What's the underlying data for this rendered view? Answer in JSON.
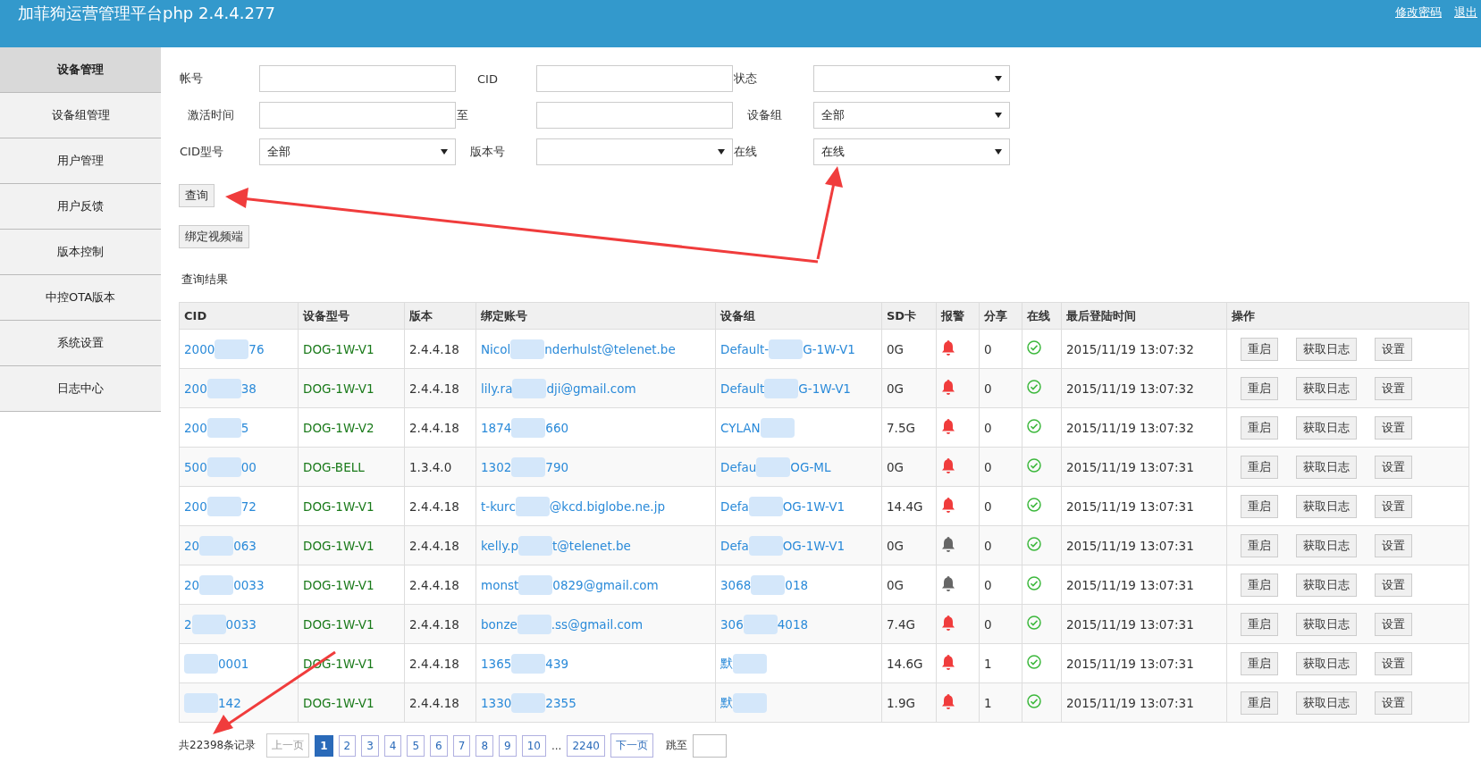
{
  "header": {
    "title": "加菲狗运营管理平台php 2.4.4.277",
    "links": [
      "修改密码",
      "退出"
    ]
  },
  "sidebar": {
    "items": [
      {
        "label": "设备管理",
        "selected": true
      },
      {
        "label": "设备组管理",
        "selected": false
      },
      {
        "label": "用户管理",
        "selected": false
      },
      {
        "label": "用户反馈",
        "selected": false
      },
      {
        "label": "版本控制",
        "selected": false
      },
      {
        "label": "中控OTA版本",
        "selected": false
      },
      {
        "label": "系统设置",
        "selected": false
      },
      {
        "label": "日志中心",
        "selected": false
      }
    ]
  },
  "filters": [
    {
      "label": "帐号",
      "kind": "text"
    },
    {
      "label": "CID",
      "kind": "text"
    },
    {
      "label": "状态",
      "kind": "select"
    },
    {
      "label": "激活时间",
      "kind": "text"
    },
    {
      "label": "至",
      "kind": "text"
    },
    {
      "label": "设备组",
      "kind": "select",
      "value": "全部"
    },
    {
      "label": "CID型号",
      "kind": "select",
      "value": "全部"
    },
    {
      "label": "版本号",
      "kind": "select"
    },
    {
      "label": "在线",
      "kind": "select",
      "value": "在线"
    }
  ],
  "buttons": [
    "查询",
    "绑定视频端"
  ],
  "results_label": "查询结果",
  "table": {
    "columns": [
      "CID",
      "设备型号",
      "版本",
      "绑定账号",
      "设备组",
      "SD卡",
      "报警",
      "分享",
      "在线",
      "最后登陆时间",
      "操作"
    ],
    "rows": [
      {
        "cid": [
          "2000",
          "76"
        ],
        "model": "DOG-1W-V1",
        "version": "2.4.4.18",
        "account": [
          "Nicol",
          "nderhulst@telenet.be"
        ],
        "group": [
          "Default-",
          "G-1W-V1"
        ],
        "sd": "0G",
        "alarm": true,
        "share": "0",
        "online": true,
        "last_login": "2015/11/19 13:07:32",
        "actions": [
          "重启",
          "获取日志",
          "设置"
        ]
      },
      {
        "cid": [
          "200",
          "38"
        ],
        "model": "DOG-1W-V1",
        "version": "2.4.4.18",
        "account": [
          "lily.ra",
          "dji@gmail.com"
        ],
        "group": [
          "Default",
          "G-1W-V1"
        ],
        "sd": "0G",
        "alarm": true,
        "share": "0",
        "online": true,
        "last_login": "2015/11/19 13:07:32",
        "actions": [
          "重启",
          "获取日志",
          "设置"
        ]
      },
      {
        "cid": [
          "200",
          "5"
        ],
        "model": "DOG-1W-V2",
        "version": "2.4.4.18",
        "account": [
          "1874",
          "660"
        ],
        "group": [
          "CYLAN"
        ],
        "sd": "7.5G",
        "alarm": true,
        "share": "0",
        "online": true,
        "last_login": "2015/11/19 13:07:32",
        "actions": [
          "重启",
          "获取日志",
          "设置"
        ]
      },
      {
        "cid": [
          "500",
          "00"
        ],
        "model": "DOG-BELL",
        "version": "1.3.4.0",
        "account": [
          "1302",
          "790"
        ],
        "group": [
          "Defau",
          "OG-ML"
        ],
        "sd": "0G",
        "alarm": true,
        "share": "0",
        "online": true,
        "last_login": "2015/11/19 13:07:31",
        "actions": [
          "重启",
          "获取日志",
          "设置"
        ]
      },
      {
        "cid": [
          "200",
          "72"
        ],
        "model": "DOG-1W-V1",
        "version": "2.4.4.18",
        "account": [
          "t-kurc",
          "@kcd.biglobe.ne.jp"
        ],
        "group": [
          "Defa",
          "OG-1W-V1"
        ],
        "sd": "14.4G",
        "alarm": true,
        "share": "0",
        "online": true,
        "last_login": "2015/11/19 13:07:31",
        "actions": [
          "重启",
          "获取日志",
          "设置"
        ]
      },
      {
        "cid": [
          "20",
          "063"
        ],
        "model": "DOG-1W-V1",
        "version": "2.4.4.18",
        "account": [
          "kelly.p",
          "t@telenet.be"
        ],
        "group": [
          "Defa",
          "OG-1W-V1"
        ],
        "sd": "0G",
        "alarm": false,
        "share": "0",
        "online": true,
        "last_login": "2015/11/19 13:07:31",
        "actions": [
          "重启",
          "获取日志",
          "设置"
        ]
      },
      {
        "cid": [
          "20",
          "0033"
        ],
        "model": "DOG-1W-V1",
        "version": "2.4.4.18",
        "account": [
          "monst",
          "0829@gmail.com"
        ],
        "group": [
          "3068",
          "018"
        ],
        "sd": "0G",
        "alarm": false,
        "share": "0",
        "online": true,
        "last_login": "2015/11/19 13:07:31",
        "actions": [
          "重启",
          "获取日志",
          "设置"
        ]
      },
      {
        "cid": [
          "2",
          "0033"
        ],
        "model": "DOG-1W-V1",
        "version": "2.4.4.18",
        "account": [
          "bonze",
          ".ss@gmail.com"
        ],
        "group": [
          "306",
          "4018"
        ],
        "sd": "7.4G",
        "alarm": true,
        "share": "0",
        "online": true,
        "last_login": "2015/11/19 13:07:31",
        "actions": [
          "重启",
          "获取日志",
          "设置"
        ]
      },
      {
        "cid": [
          "0001"
        ],
        "model": "DOG-1W-V1",
        "version": "2.4.4.18",
        "account": [
          "1365",
          "439"
        ],
        "group": [
          "默"
        ],
        "sd": "14.6G",
        "alarm": true,
        "share": "1",
        "online": true,
        "last_login": "2015/11/19 13:07:31",
        "actions": [
          "重启",
          "获取日志",
          "设置"
        ]
      },
      {
        "cid": [
          "142"
        ],
        "model": "DOG-1W-V1",
        "version": "2.4.4.18",
        "account": [
          "1330",
          "2355"
        ],
        "group": [
          "默"
        ],
        "sd": "1.9G",
        "alarm": true,
        "share": "1",
        "online": true,
        "last_login": "2015/11/19 13:07:31",
        "actions": [
          "重启",
          "获取日志",
          "设置"
        ]
      }
    ]
  },
  "pagination": {
    "total": "共22398条记录",
    "prev": {
      "label": "上一页",
      "disabled": true
    },
    "pages": [
      {
        "label": "1",
        "selected": true
      },
      {
        "label": "2",
        "selected": false
      },
      {
        "label": "3",
        "selected": false
      },
      {
        "label": "4",
        "selected": false
      },
      {
        "label": "5",
        "selected": false
      },
      {
        "label": "6",
        "selected": false
      },
      {
        "label": "7",
        "selected": false
      },
      {
        "label": "8",
        "selected": false
      },
      {
        "label": "9",
        "selected": false
      },
      {
        "label": "10",
        "selected": false
      }
    ],
    "ellipsis": "...",
    "last": "2240",
    "next": {
      "label": "下一页",
      "disabled": false
    },
    "jump_label": "跳至"
  }
}
